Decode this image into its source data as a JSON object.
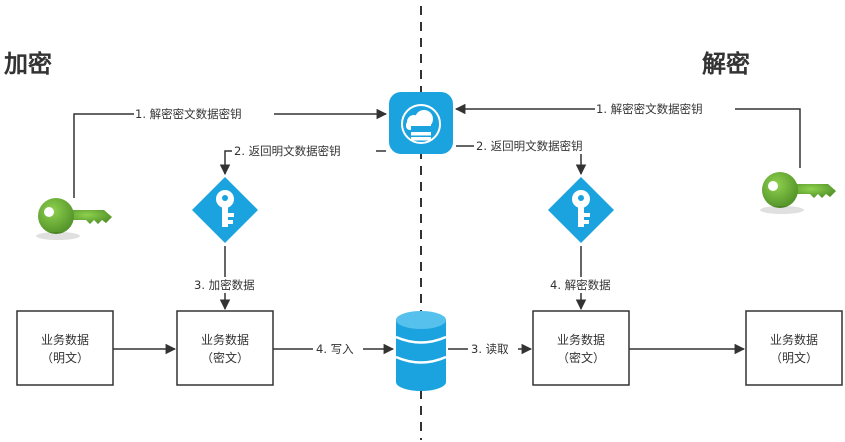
{
  "headings": {
    "encrypt": "加密",
    "decrypt": "解密"
  },
  "arrows": {
    "left_decrypt_key": "1. 解密密文数据密钥",
    "left_return_key": "2. 返回明文数据密钥",
    "left_encrypt_data": "3. 加密数据",
    "write": "4. 写入",
    "right_decrypt_key": "1. 解密密文数据密钥",
    "right_return_key": "2. 返回明文数据密钥",
    "right_decrypt_data": "4. 解密数据",
    "read": "3. 读取"
  },
  "boxes": {
    "left_plain": {
      "line1": "业务数据",
      "line2": "（明文）"
    },
    "left_cipher": {
      "line1": "业务数据",
      "line2": "（密文）"
    },
    "right_cipher": {
      "line1": "业务数据",
      "line2": "（密文）"
    },
    "right_plain": {
      "line1": "业务数据",
      "line2": "（明文）"
    }
  },
  "icons": {
    "kms": "cloud-server-icon",
    "database": "database-icon",
    "master_key": "green-key-icon",
    "data_key": "blue-key-diamond-icon"
  },
  "colors": {
    "blue": "#1aa3de",
    "green": "#5ea532",
    "line": "#333333"
  }
}
